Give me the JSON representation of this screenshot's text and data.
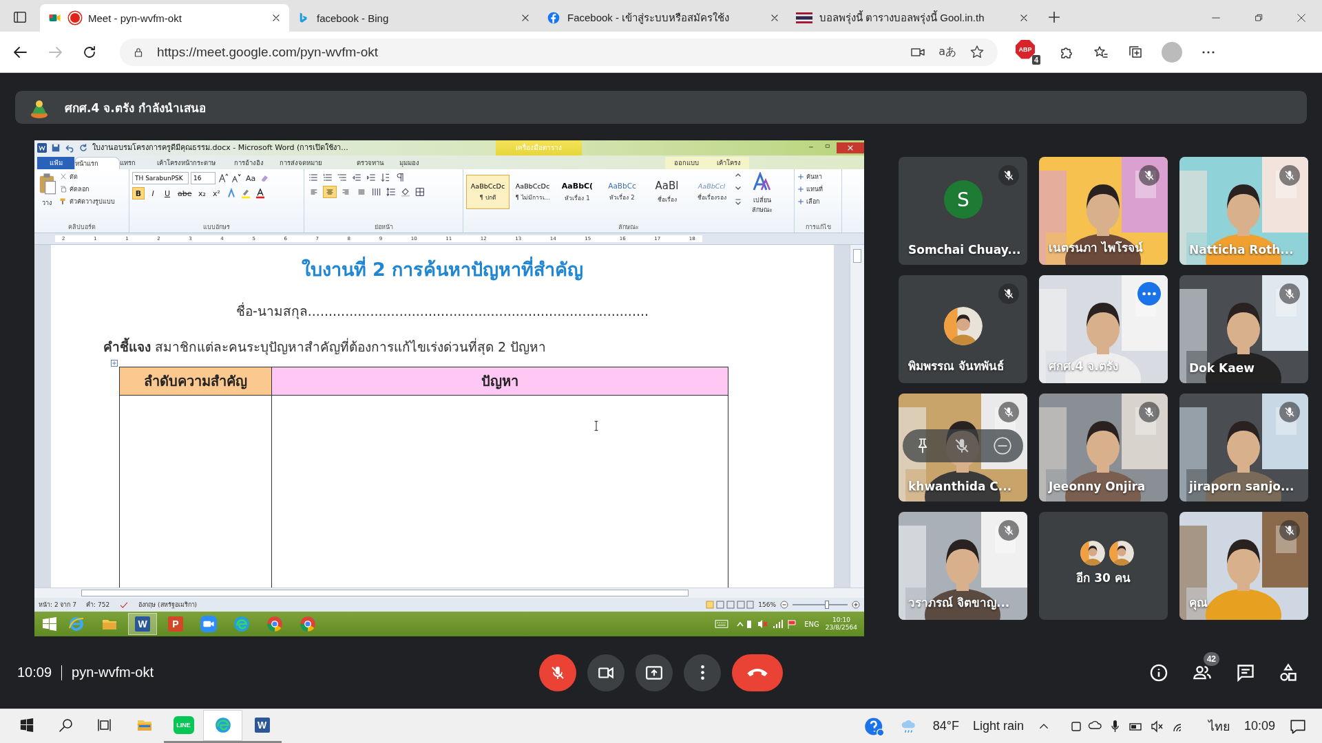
{
  "browser": {
    "tabs": [
      {
        "kind": "meet",
        "title": "Meet - pyn-wvfm-okt",
        "selected": true,
        "recording": true
      },
      {
        "kind": "bing",
        "title": "facebook - Bing",
        "selected": false,
        "recording": false
      },
      {
        "kind": "facebook",
        "title": "Facebook - เข้าสู่ระบบหรือสมัครใช้ง",
        "selected": false,
        "recording": false
      },
      {
        "kind": "flag",
        "title": "บอลพรุ่งนี้ ตารางบอลพรุ่งนี้ Gool.in.th",
        "selected": false,
        "recording": false
      }
    ],
    "url": "https://meet.google.com/pyn-wvfm-okt",
    "read_aloud": "aあ",
    "extension_label": "ABP",
    "extension_badge": "4"
  },
  "presentation": {
    "banner": "ศกศ.4 จ.ตรัง กำลังนำเสนอ"
  },
  "word": {
    "title": "ใบงานอบรมโครงการครูดีมีคุณธรรม.docx - Microsoft Word (การเปิดใช้งา...",
    "context_tab": "เครื่องมือตาราง",
    "tabs": [
      {
        "label": "แฟ้ม",
        "kind": "file",
        "selected": false
      },
      {
        "label": "หน้าแรก",
        "kind": "tab",
        "selected": true
      },
      {
        "label": "แทรก",
        "kind": "tab",
        "selected": false
      },
      {
        "label": "เค้าโครงหน้ากระดาษ",
        "kind": "tab",
        "selected": false
      },
      {
        "label": "การอ้างอิง",
        "kind": "tab",
        "selected": false
      },
      {
        "label": "การส่งจดหมาย",
        "kind": "tab",
        "selected": false
      },
      {
        "label": "ตรวจทาน",
        "kind": "tab",
        "selected": false
      },
      {
        "label": "มุมมอง",
        "kind": "tab",
        "selected": false
      },
      {
        "label": "ออกแบบ",
        "kind": "context",
        "selected": false
      },
      {
        "label": "เค้าโครง",
        "kind": "context",
        "selected": false
      }
    ],
    "clipboard": {
      "paste": "วาง",
      "cut": "ตัด",
      "copy": "คัดลอก",
      "format_painter": "ตัวคัดวางรูปแบบ"
    },
    "font": {
      "name": "TH SarabunPSK",
      "size": "16",
      "case": "Aa",
      "tools": [
        {
          "label": "B",
          "on": true
        },
        {
          "label": "I",
          "on": false
        },
        {
          "label": "U",
          "on": false
        },
        {
          "label": "abe",
          "on": false
        },
        {
          "label": "x₂",
          "on": false
        },
        {
          "label": "x²",
          "on": false
        }
      ]
    },
    "paragraph": {
      "align": [
        {
          "on": false
        },
        {
          "on": true
        },
        {
          "on": false
        },
        {
          "on": false
        }
      ]
    },
    "styles": [
      {
        "sample": "AaBbCcDc",
        "label": "¶ ปกติ",
        "kind": "normal",
        "selected": true
      },
      {
        "sample": "AaBbCcDc",
        "label": "¶ ไม่มีการเ...",
        "kind": "normal",
        "selected": false
      },
      {
        "sample": "AaBbC(",
        "label": "หัวเรื่อง 1",
        "kind": "heading",
        "selected": false
      },
      {
        "sample": "AaBbCc",
        "label": "หัวเรื่อง 2",
        "kind": "heading2",
        "selected": false
      },
      {
        "sample": "AaBl",
        "label": "ชื่อเรื่อง",
        "kind": "title",
        "selected": false
      },
      {
        "sample": "AaBbCcl",
        "label": "ชื่อเรื่องรอง",
        "kind": "subtitle",
        "selected": false
      }
    ],
    "change_styles": "เปลี่ยนลักษณะ",
    "editing": [
      "ค้นหา",
      "แทนที่",
      "เลือก"
    ],
    "groups": [
      "คลิปบอร์ด",
      "แบบอักษร",
      "ย่อหน้า",
      "ลักษณะ",
      "การแก้ไข"
    ],
    "ruler": [
      "2",
      "1",
      "1",
      "2",
      "3",
      "4",
      "5",
      "6",
      "7",
      "8",
      "9",
      "10",
      "11",
      "12",
      "13",
      "14",
      "15",
      "16",
      "17",
      "18"
    ],
    "document": {
      "title": "ใบงานที่ 2 การค้นหาปัญหาที่สำคัญ",
      "name_line": "ชื่อ-นามสกุล..................................................................................",
      "instruction": "**คำชี้แจง** สมาชิกแต่ละคนระบุปัญหาสำคัญที่ต้องการแก้ไขเร่งด่วนที่สุด 2 ปัญหา",
      "table_headers": [
        "ลำดับความสำคัญ",
        "ปัญหา"
      ]
    },
    "status": {
      "page": "หน้า: 2 จาก 7",
      "words": "คำ: 752",
      "language": "อังกฤษ (สหรัฐอเมริกา)",
      "zoom": "156%",
      "zoom_slider": {
        "level": 0.62
      }
    },
    "taskbar": {
      "apps": [
        {
          "kind": "ie",
          "selected": false
        },
        {
          "kind": "explorer",
          "selected": false
        },
        {
          "kind": "word",
          "label": "W",
          "selected": true
        },
        {
          "kind": "powerpoint",
          "label": "P",
          "selected": false
        },
        {
          "kind": "zoom",
          "selected": false
        },
        {
          "kind": "edge",
          "selected": false
        },
        {
          "kind": "chrome",
          "selected": false
        },
        {
          "kind": "chrome",
          "selected": false
        }
      ],
      "language": "ENG",
      "time": "10:10",
      "date": "23/8/2564"
    }
  },
  "participants": [
    {
      "name": "Somchai Chuay...",
      "kind": "letter",
      "letter": "S",
      "muted": true,
      "selected": false,
      "hovered": false
    },
    {
      "name": "เนตรนภา ไพโรจน์",
      "kind": "video",
      "muted": true,
      "selected": false,
      "hovered": false
    },
    {
      "name": "Natticha Roth...",
      "kind": "video",
      "muted": true,
      "selected": false,
      "hovered": false
    },
    {
      "name": "พิมพรรณ จันทพันธ์",
      "muted": true,
      "selected": false,
      "hovered": false
    },
    {
      "name": "ศกศ.4 จ.ตรัง",
      "kind": "video",
      "muted": false,
      "selected": true,
      "hovered": false
    },
    {
      "name": "Dok Kaew",
      "kind": "video",
      "muted": true,
      "selected": false,
      "hovered": false
    },
    {
      "name": "khwanthida C...",
      "kind": "video",
      "muted": true,
      "selected": false,
      "hovered": true
    },
    {
      "name": "Jeeonny Onjira",
      "kind": "video",
      "muted": true,
      "selected": false,
      "hovered": false
    },
    {
      "name": "jiraporn sanjo...",
      "kind": "video",
      "muted": true,
      "selected": false,
      "hovered": false
    },
    {
      "name": "วราภรณ์ จิตขาญ...",
      "kind": "video",
      "muted": true,
      "selected": false,
      "hovered": false
    },
    {
      "name": "อีก 30 คน",
      "kind": "more",
      "muted": false,
      "selected": false,
      "hovered": false
    },
    {
      "name": "คุณ",
      "kind": "video",
      "muted": true,
      "selected": false,
      "hovered": false
    }
  ],
  "meeting": {
    "time": "10:09",
    "code": "pyn-wvfm-okt",
    "mic_on": false,
    "people_count": "42"
  },
  "taskbar": {
    "apps": [
      {
        "kind": "explorer",
        "running": false,
        "selected": false
      },
      {
        "kind": "line",
        "label": "LINE",
        "running": true,
        "selected": false
      },
      {
        "kind": "edge",
        "running": true,
        "selected": true
      },
      {
        "kind": "word",
        "label": "W",
        "running": true,
        "selected": false
      }
    ],
    "weather_temp": "84°F",
    "weather_text": "Light rain",
    "language": "ไทย",
    "time": "10:09"
  }
}
